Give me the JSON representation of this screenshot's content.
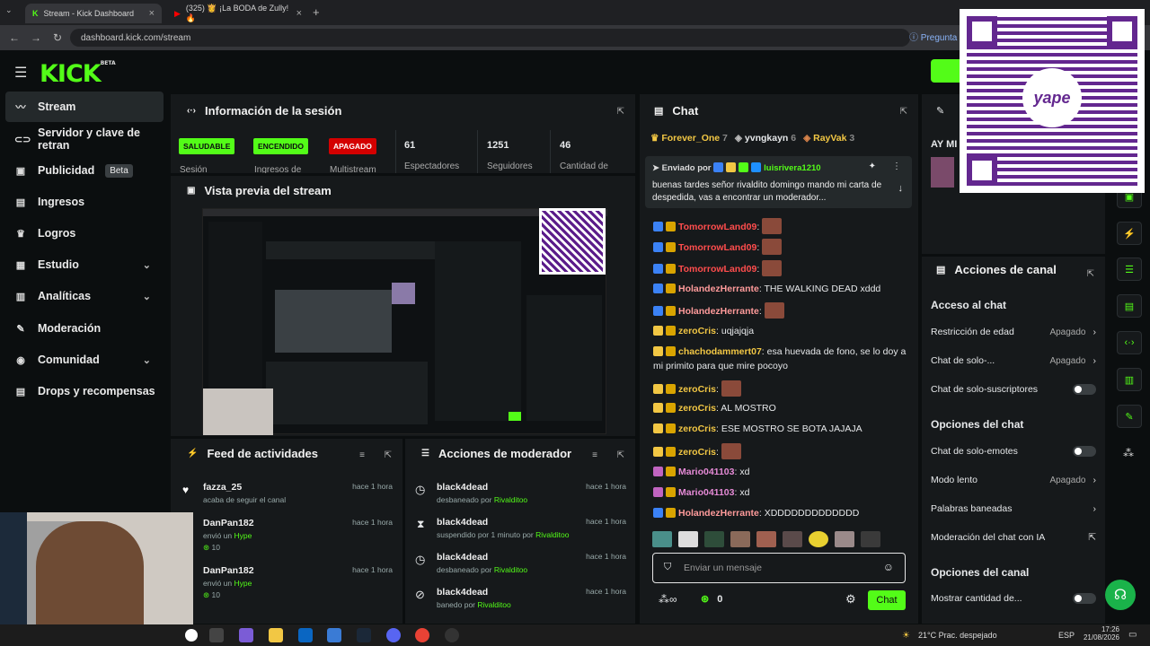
{
  "browser": {
    "tabs": [
      {
        "title": "Stream - Kick Dashboard",
        "active": true
      },
      {
        "title": "(325) 👸 ¡La BODA de Zully! 🔥",
        "active": false
      }
    ],
    "url": "dashboard.kick.com/stream",
    "ask_label": "Pregunta"
  },
  "brand": {
    "logo": "KICK",
    "beta": "BETA",
    "accent": "#53fc18"
  },
  "sidebar": {
    "items": [
      {
        "label": "Stream",
        "icon": "wave-icon"
      },
      {
        "label": "Servidor y clave de retran",
        "icon": "link-icon"
      },
      {
        "label": "Publicidad",
        "icon": "ad-icon",
        "badge": "Beta"
      },
      {
        "label": "Ingresos",
        "icon": "dollar-icon"
      },
      {
        "label": "Logros",
        "icon": "trophy-icon"
      },
      {
        "label": "Estudio",
        "icon": "studio-icon"
      },
      {
        "label": "Analíticas",
        "icon": "chart-icon"
      },
      {
        "label": "Moderación",
        "icon": "wrench-icon"
      },
      {
        "label": "Comunidad",
        "icon": "people-icon"
      },
      {
        "label": "Drops y recompensas",
        "icon": "gift-icon"
      }
    ]
  },
  "session": {
    "title": "Información de la sesión",
    "pills": [
      "SALUDABLE",
      "ENCENDIDO",
      "APAGADO"
    ],
    "pill_labels": [
      "Sesión",
      "Ingresos de",
      "Multistream"
    ],
    "stats": [
      {
        "value": "61",
        "label": "Espectadores"
      },
      {
        "value": "1251",
        "label": "Seguidores"
      },
      {
        "value": "46",
        "label": "Cantidad de"
      }
    ]
  },
  "preview": {
    "title": "Vista previa del stream"
  },
  "feed": {
    "title": "Feed de actividades",
    "items": [
      {
        "name": "fazza_25",
        "sub": "acaba de seguir el canal",
        "time": "hace 1 hora"
      },
      {
        "name": "DanPan182",
        "sub_pre": "envió un",
        "sub_hl": "Hype",
        "amount": "10",
        "time": "hace 1 hora"
      },
      {
        "name": "DanPan182",
        "sub_pre": "envió un",
        "sub_hl": "Hype",
        "amount": "10",
        "time": "hace 1 hora"
      }
    ]
  },
  "modactions": {
    "title": "Acciones de moderador",
    "items": [
      {
        "name": "black4dead",
        "action": "desbaneado por",
        "by": "Rivalditoo",
        "time": "hace 1 hora"
      },
      {
        "name": "black4dead",
        "action": "suspendido por 1 minuto por",
        "by": "Rivalditoo",
        "time": "hace 1 hora"
      },
      {
        "name": "black4dead",
        "action": "desbaneado por",
        "by": "Rivalditoo",
        "time": "hace 1 hora"
      },
      {
        "name": "black4dead",
        "action": "banedo por",
        "by": "Rivalditoo",
        "time": "hace 1 hora"
      }
    ]
  },
  "chat": {
    "title": "Chat",
    "top_gifters": [
      {
        "name": "Forever_One",
        "count": "7"
      },
      {
        "name": "yvngkayn",
        "count": "6"
      },
      {
        "name": "RayVak",
        "count": "3"
      }
    ],
    "pinned": {
      "label": "Enviado por",
      "user": "luisrivera1210",
      "text": "buenas tardes señor rivaldito domingo mando mi carta de despedida, vas a encontrar un moderador..."
    },
    "messages": [
      {
        "user": "TomorrowLand09",
        "color": "#ff4d4d",
        "text": "",
        "emote": true
      },
      {
        "user": "TomorrowLand09",
        "color": "#ff4d4d",
        "text": "",
        "emote": true
      },
      {
        "user": "TomorrowLand09",
        "color": "#ff4d4d",
        "text": "",
        "emote": true
      },
      {
        "user": "HolandezHerrante",
        "color": "#ff9b9b",
        "text": "THE WALKING DEAD xddd"
      },
      {
        "user": "HolandezHerrante",
        "color": "#ff9b9b",
        "text": "",
        "emote": true
      },
      {
        "user": "zeroCris",
        "color": "#f2c744",
        "text": "uqjajqja"
      },
      {
        "user": "chachodammert07",
        "color": "#f2c744",
        "text": "esa huevada de fono, se lo doy a mi primito para que mire pocoyo"
      },
      {
        "user": "zeroCris",
        "color": "#f2c744",
        "text": "",
        "emote": true
      },
      {
        "user": "zeroCris",
        "color": "#f2c744",
        "text": "AL MOSTRO"
      },
      {
        "user": "zeroCris",
        "color": "#f2c744",
        "text": "ESE MOSTRO SE BOTA JAJAJA"
      },
      {
        "user": "zeroCris",
        "color": "#f2c744",
        "text": "",
        "emote": true
      },
      {
        "user": "Mario041103",
        "color": "#e58ad6",
        "text": "xd"
      },
      {
        "user": "Mario041103",
        "color": "#e58ad6",
        "text": "xd"
      },
      {
        "user": "HolandezHerrante",
        "color": "#ff9b9b",
        "text": "XDDDDDDDDDDDDD"
      }
    ],
    "input_placeholder": "Enviar un mensaje",
    "points": "0",
    "send_label": "Chat"
  },
  "channel_actions": {
    "title": "Acciones de canal",
    "sections": [
      {
        "header": "Acceso al chat",
        "rows": [
          {
            "label": "Restricción de edad",
            "value": "Apagado",
            "type": "select"
          },
          {
            "label": "Chat de solo-...",
            "value": "Apagado",
            "type": "select"
          },
          {
            "label": "Chat de solo-suscriptores",
            "type": "toggle"
          }
        ]
      },
      {
        "header": "Opciones del chat",
        "rows": [
          {
            "label": "Chat de solo-emotes",
            "type": "toggle"
          },
          {
            "label": "Modo lento",
            "value": "Apagado",
            "type": "select"
          },
          {
            "label": "Palabras baneadas",
            "type": "link"
          },
          {
            "label": "Moderación del chat con IA",
            "type": "external"
          }
        ]
      },
      {
        "header": "Opciones del canal",
        "rows": [
          {
            "label": "Mostrar cantidad de...",
            "type": "toggle"
          }
        ]
      }
    ]
  },
  "overlay": {
    "qr_brand": "yape",
    "partial_header": "AY MI"
  },
  "taskbar": {
    "weather": "21°C  Prac. despejado",
    "lang": "ESP",
    "time": "17:26",
    "date": "21/08/2026"
  }
}
